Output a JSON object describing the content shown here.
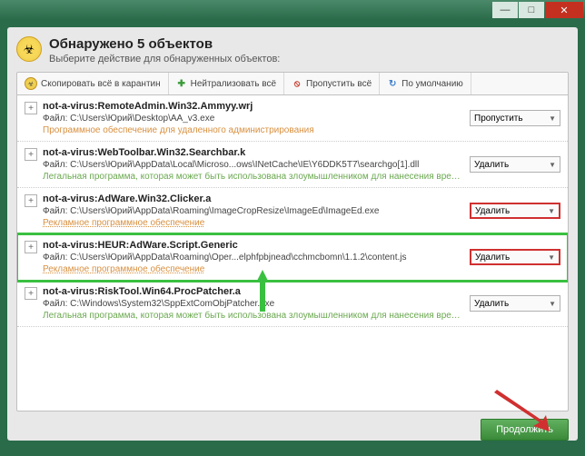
{
  "titlebar": {
    "min": "—",
    "max": "□",
    "close": "✕"
  },
  "header": {
    "title": "Обнаружено 5 объектов",
    "subtitle": "Выберите действие для обнаруженных объектов:"
  },
  "toolbar": {
    "quarantine": "Скопировать всё в карантин",
    "neutralize": "Нейтрализовать всё",
    "skip": "Пропустить всё",
    "default": "По умолчанию"
  },
  "rows": [
    {
      "threat": "not-a-virus:RemoteAdmin.Win32.Ammyy.wrj",
      "path": "Файл: C:\\Users\\Юрий\\Desktop\\AA_v3.exe",
      "desc": "Программное обеспечение для удаленного администрирования",
      "descClass": "d-orange",
      "action": "Пропустить"
    },
    {
      "threat": "not-a-virus:WebToolbar.Win32.Searchbar.k",
      "path": "Файл: C:\\Users\\Юрий\\AppData\\Local\\Microso...ows\\INetCache\\IE\\Y6DDK5T7\\searchgo[1].dll",
      "desc": "Легальная программа, которая может быть использована злоумышленником для нанесения вреда компьютеру ил...",
      "descClass": "d-green",
      "action": "Удалить"
    },
    {
      "threat": "not-a-virus:AdWare.Win32.Clicker.a",
      "path": "Файл: C:\\Users\\Юрий\\AppData\\Roaming\\ImageCropResize\\ImageEd\\ImageEd.exe",
      "desc": "Рекламное программное обеспечение",
      "descClass": "d-orange d-under",
      "action": "Удалить",
      "actionRed": true
    },
    {
      "threat": "not-a-virus:HEUR:AdWare.Script.Generic",
      "path": "Файл: C:\\Users\\Юрий\\AppData\\Roaming\\Oper...elphfpbjnead\\cchmcbomn\\1.1.2\\content.js",
      "desc": "Рекламное программное обеспечение",
      "descClass": "d-orange d-under",
      "action": "Удалить",
      "actionRed": true,
      "highlight": true
    },
    {
      "threat": "not-a-virus:RiskTool.Win64.ProcPatcher.a",
      "path": "Файл: C:\\Windows\\System32\\SppExtComObjPatcher.exe",
      "desc": "Легальная программа, которая может быть использована злоумышленником для нанесения вреда компьютеру ил...",
      "descClass": "d-green",
      "action": "Удалить"
    }
  ],
  "footer": {
    "continue": "Продолжить"
  },
  "icons": {
    "expand": "+",
    "hazard": "☣"
  }
}
